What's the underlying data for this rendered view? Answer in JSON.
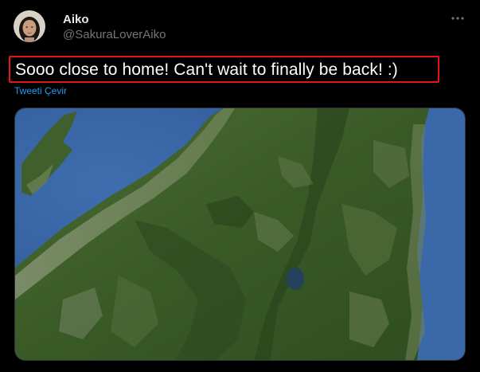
{
  "user": {
    "display_name": "Aiko",
    "handle": "@SakuraLoverAiko"
  },
  "tweet": {
    "text": "Sooo close to home! Can't wait to finally be back! :)",
    "translate_label": "Tweeti Çevir"
  },
  "icons": {
    "more": "more-horizontal-icon"
  },
  "colors": {
    "background": "#000000",
    "text_primary": "#e7e9ea",
    "text_secondary": "#71767b",
    "link": "#1d9bf0",
    "highlight_border": "#e21616"
  }
}
